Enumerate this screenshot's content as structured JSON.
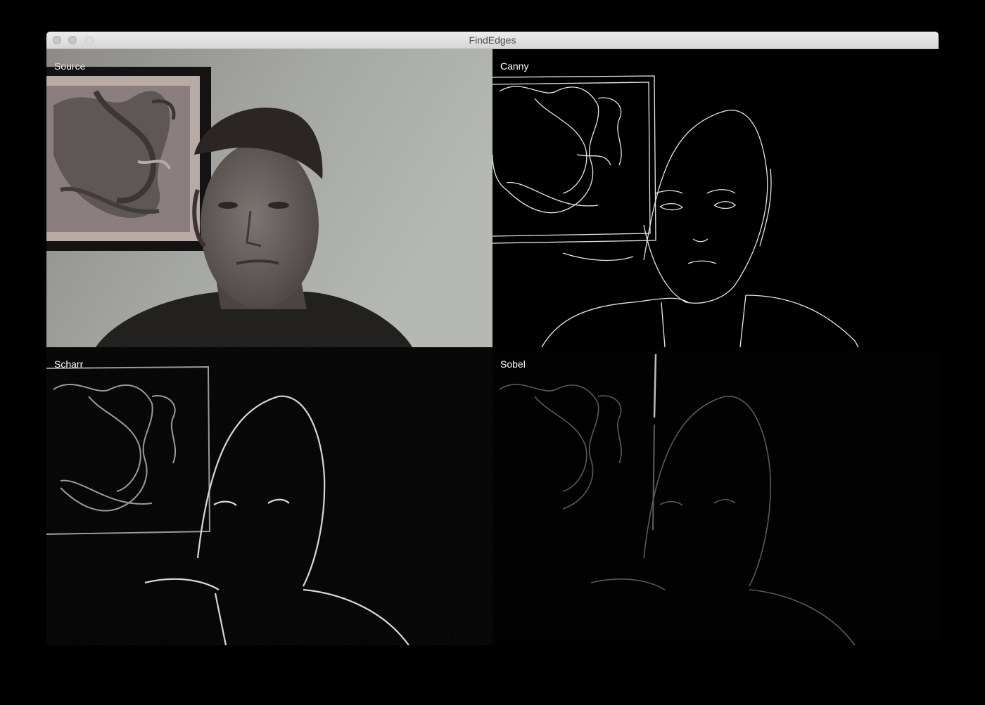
{
  "window": {
    "title": "FindEdges",
    "controls": [
      "close-button",
      "minimize-button",
      "zoom-button"
    ]
  },
  "panels": {
    "source": {
      "label": "Source"
    },
    "canny": {
      "label": "Canny"
    },
    "scharr": {
      "label": "Scharr"
    },
    "sobel": {
      "label": "Sobel"
    }
  },
  "colors": {
    "titlebar": "#e0e0e0",
    "background": "#000000",
    "label_text": "#ffffff"
  }
}
